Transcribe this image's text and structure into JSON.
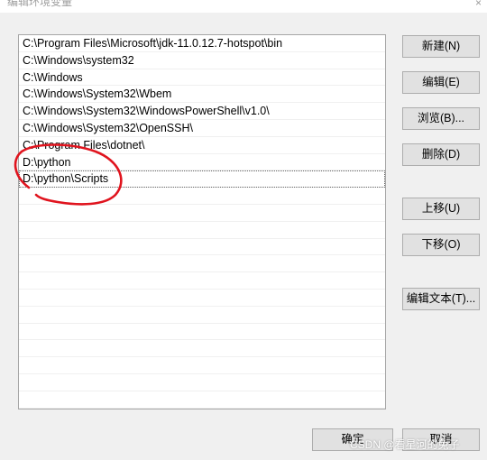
{
  "window": {
    "title": "编辑环境变量",
    "close_glyph": "×"
  },
  "paths": [
    "C:\\Program Files\\Microsoft\\jdk-11.0.12.7-hotspot\\bin",
    "C:\\Windows\\system32",
    "C:\\Windows",
    "C:\\Windows\\System32\\Wbem",
    "C:\\Windows\\System32\\WindowsPowerShell\\v1.0\\",
    "C:\\Windows\\System32\\OpenSSH\\",
    "C:\\Program Files\\dotnet\\",
    "D:\\python",
    "D:\\python\\Scripts"
  ],
  "buttons": {
    "new": "新建(N)",
    "edit": "编辑(E)",
    "browse": "浏览(B)...",
    "delete": "删除(D)",
    "move_up": "上移(U)",
    "move_down": "下移(O)",
    "edit_text": "编辑文本(T)...",
    "ok": "确定",
    "cancel": "取消"
  },
  "watermark": "CSDN @看星河的兔子",
  "colors": {
    "annotation": "#e0141e",
    "list_bg": "#ffffff",
    "button_bg": "#e1e1e1"
  }
}
